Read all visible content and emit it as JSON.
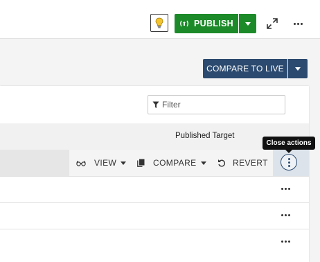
{
  "topbar": {
    "publish_label": "PUBLISH",
    "publish_icon": "broadcast-icon",
    "accent_green": "#1d8a2a"
  },
  "toolbar": {
    "compare_to_live_label": "COMPARE TO LIVE",
    "accent_navy": "#2c4a6f"
  },
  "filter": {
    "placeholder": "Filter"
  },
  "table": {
    "column_header": "Published Target",
    "actions": {
      "view_label": "VIEW",
      "compare_label": "COMPARE",
      "revert_label": "REVERT"
    },
    "rows": [
      {
        "id": 1
      },
      {
        "id": 2
      },
      {
        "id": 3
      }
    ]
  },
  "tooltip": {
    "text": "Close actions"
  }
}
